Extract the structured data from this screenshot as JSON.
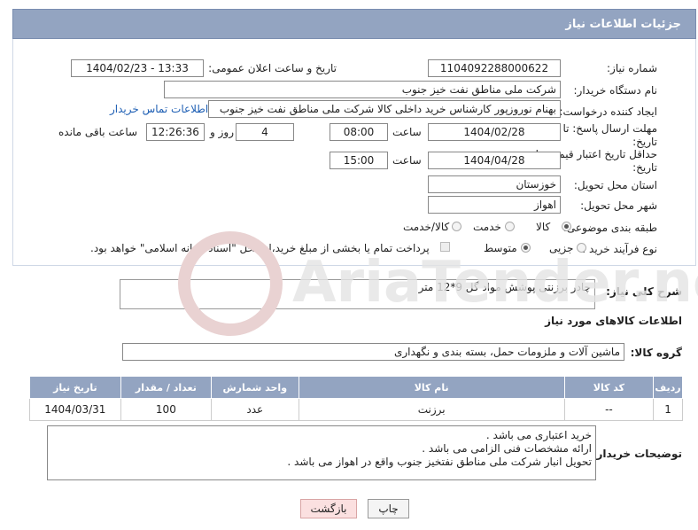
{
  "header": {
    "title": "جزئیات اطلاعات نیاز"
  },
  "fields": {
    "need_number_label": "شماره نیاز:",
    "need_number": "1104092288000622",
    "announce_label": "تاریخ و ساعت اعلان عمومی:",
    "announce_value": "1404/02/23 - 13:33",
    "buyer_org_label": "نام دستگاه خریدار:",
    "buyer_org": "شرکت ملی مناطق نفت خیز جنوب",
    "creator_label": "ایجاد کننده درخواست:",
    "creator": "بهنام  نوروزپور کارشناس خرید داخلی کالا شرکت ملی مناطق نفت خیز جنوب",
    "contact_link": "اطلاعات تماس خریدار",
    "deadline_label": "مهلت ارسال پاسخ: تا تاریخ:",
    "deadline_date": "1404/02/28",
    "time_label": "ساعت",
    "deadline_time": "08:00",
    "days_value": "4",
    "days_label": "روز و",
    "remaining_time": "12:26:36",
    "remaining_label": "ساعت باقی مانده",
    "validity_label": "حداقل تاریخ اعتبار قیمت: تا تاریخ:",
    "validity_date": "1404/04/28",
    "validity_time": "15:00",
    "province_label": "استان محل تحویل:",
    "province": "خوزستان",
    "city_label": "شهر محل تحویل:",
    "city": "اهواز",
    "category_label": "طبقه بندی موضوعی:",
    "category_options": [
      "کالا",
      "خدمت",
      "کالا/خدمت"
    ],
    "process_label": "نوع فرآیند خرید :",
    "process_options": [
      "جزیی",
      "متوسط"
    ],
    "payment_note": "پرداخت تمام یا بخشی از مبلغ خرید،از محل \"اسناد خزانه اسلامی\" خواهد بود."
  },
  "summary": {
    "label": "شرح کلی نیاز:",
    "value": "چادر برزنتی پوشش مواد گل 9*12 متر"
  },
  "goods": {
    "section_title": "اطلاعات کالاهای مورد نیاز",
    "group_label": "گروه کالا:",
    "group_value": "ماشین آلات و ملزومات حمل، بسته بندی و نگهداری",
    "columns": [
      "ردیف",
      "کد کالا",
      "نام کالا",
      "واحد شمارش",
      "تعداد / مقدار",
      "تاریخ نیاز"
    ],
    "rows": [
      [
        "1",
        "--",
        "برزنت",
        "عدد",
        "100",
        "1404/03/31"
      ]
    ]
  },
  "buyer_notes": {
    "label": "توضیحات خریدار:",
    "lines": [
      "خرید اعتباری می باشد .",
      "ارائه مشخصات فنی الزامی می باشد .",
      "تحویل انبار شرکت ملی مناطق نفتخیز جنوب واقع در اهواز می باشد  ."
    ]
  },
  "buttons": {
    "print": "چاپ",
    "back": "بازگشت"
  },
  "watermark": {
    "text": "AriaTender.net"
  }
}
